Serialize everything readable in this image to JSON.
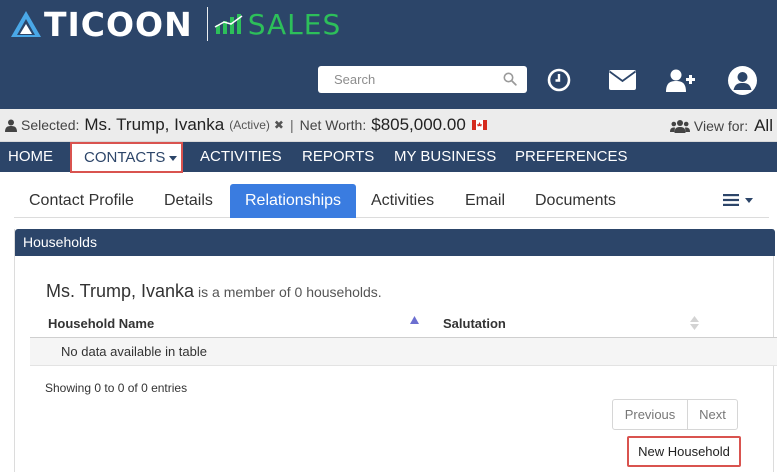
{
  "brand": {
    "name": "TICOON",
    "product": "SALES",
    "colors": {
      "header": "#2c4569",
      "accent_green": "#2dbf5a",
      "active_tab": "#3a7ce0",
      "highlight": "#d9534f"
    }
  },
  "header": {
    "search_placeholder": "Search",
    "icons": [
      "search-icon",
      "clock-icon",
      "envelope-icon",
      "add-user-icon",
      "user-circle-icon"
    ]
  },
  "selection": {
    "label": "Selected:",
    "name": "Ms. Trump, Ivanka",
    "status": "(Active)",
    "clear": "✖",
    "separator": "|",
    "net_worth_label": "Net Worth:",
    "net_worth_value": "$805,000.00",
    "view_for_label": "View for:",
    "view_for_value": "All"
  },
  "nav": {
    "items": [
      "HOME",
      "CONTACTS",
      "ACTIVITIES",
      "REPORTS",
      "MY BUSINESS",
      "PREFERENCES"
    ]
  },
  "tabs": {
    "items": [
      "Contact Profile",
      "Details",
      "Relationships",
      "Activities",
      "Email",
      "Documents"
    ],
    "active": "Relationships"
  },
  "households": {
    "title": "Households",
    "member_name": "Ms. Trump, Ivanka",
    "member_suffix": "is a member of 0 households.",
    "columns": [
      "Household Name",
      "Salutation"
    ],
    "empty_text": "No data available in table",
    "info": "Showing 0 to 0 of 0 entries",
    "previous_label": "Previous",
    "next_label": "Next",
    "new_button": "New Household"
  }
}
